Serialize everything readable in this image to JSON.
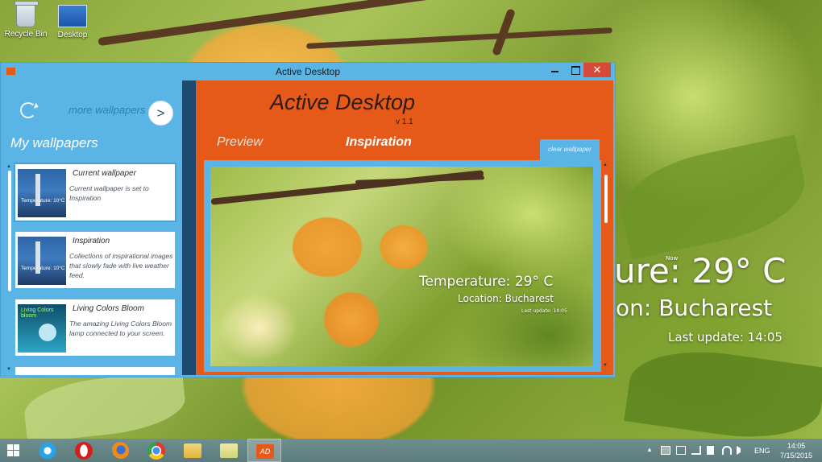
{
  "desktop": {
    "icons": [
      {
        "label": "Recycle Bin",
        "icon": "recycle-bin-icon"
      },
      {
        "label": "Desktop",
        "icon": "desktop-folder-icon"
      }
    ],
    "weather": {
      "now_label": "Now",
      "temperature": "ure: 29° C",
      "location": "on: Bucharest",
      "last_update": "Last update: 14:05"
    }
  },
  "window": {
    "title": "Active Desktop",
    "close_label": "✕",
    "sidebar": {
      "more_wallpapers": "more wallpapers",
      "next_label": ">",
      "section_title": "My wallpapers",
      "items": [
        {
          "title": "Current wallpaper",
          "desc": "Current wallpaper is set to Inspiration",
          "thumb_text": "Temperature: 10°C"
        },
        {
          "title": "Inspiration",
          "desc": "Collections of inspirational images that slowly fade with live weather feed.",
          "thumb_text": "Temperature: 10°C"
        },
        {
          "title": "Living Colors Bloom",
          "desc": "The amazing Living Colors Bloom lamp connected to your screen.",
          "thumb_text": "Living Colors bloom"
        }
      ]
    },
    "main": {
      "brand": "Active Desktop",
      "version": "v 1.1",
      "tabs": [
        "Preview",
        "Inspiration"
      ],
      "active_tab": "Inspiration",
      "clear_label": "clear wallpaper",
      "preview": {
        "temperature": "Temperature: 29° C",
        "location": "Location: Bucharest",
        "last_update": "Last update: 14:05"
      }
    }
  },
  "taskbar": {
    "apps": [
      {
        "name": "start-button",
        "icon": "windows-logo-icon"
      },
      {
        "name": "internet-explorer",
        "icon": "internet-explorer-icon"
      },
      {
        "name": "opera",
        "icon": "opera-icon"
      },
      {
        "name": "firefox",
        "icon": "firefox-icon"
      },
      {
        "name": "chrome",
        "icon": "chrome-icon"
      },
      {
        "name": "file-explorer",
        "icon": "folder-icon"
      },
      {
        "name": "sticky-notes",
        "icon": "notes-icon"
      },
      {
        "name": "active-desktop",
        "icon": "active-desktop-icon",
        "label": "AD"
      }
    ],
    "tray": {
      "language": "ENG",
      "time": "14:05",
      "date": "7/15/2015"
    }
  },
  "colors": {
    "accent_blue": "#5ab4e5",
    "accent_orange": "#e55a18",
    "divider": "#1d4a6e"
  }
}
